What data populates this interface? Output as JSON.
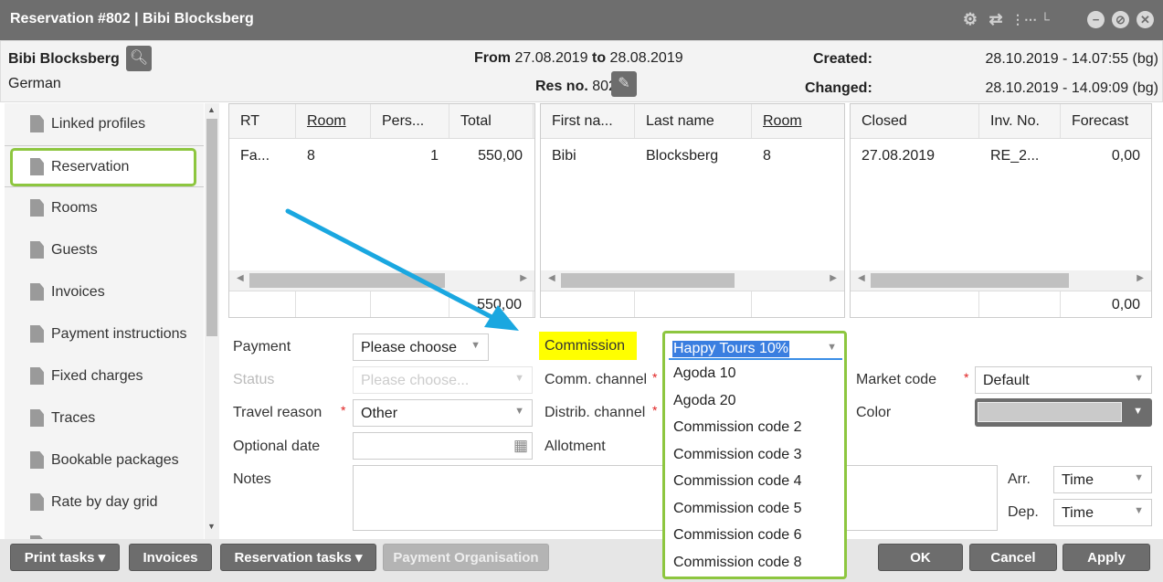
{
  "window": {
    "title": "Reservation #802 | Bibi Blocksberg",
    "icons": [
      "gear-icon",
      "swap-icon",
      "tree-icon",
      "hierarchy-icon",
      "minimize-icon",
      "restore-icon",
      "close-icon"
    ]
  },
  "header": {
    "guest_name": "Bibi Blocksberg",
    "language": "German",
    "from_label": "From",
    "from_date": "27.08.2019",
    "to_label": "to",
    "to_date": "28.08.2019",
    "resno_label": "Res no.",
    "resno": "802",
    "created_label": "Created:",
    "created": "28.10.2019 - 14.07:55 (bg)",
    "changed_label": "Changed:",
    "changed": "28.10.2019 - 14.09:09 (bg)"
  },
  "sidebar": {
    "items": [
      {
        "label": "Linked profiles"
      },
      {
        "label": "Reservation",
        "selected": true
      },
      {
        "label": "Rooms"
      },
      {
        "label": "Guests"
      },
      {
        "label": "Invoices"
      },
      {
        "label": "Payment instructions"
      },
      {
        "label": "Fixed charges"
      },
      {
        "label": "Traces"
      },
      {
        "label": "Bookable packages"
      },
      {
        "label": "Rate by day grid"
      }
    ]
  },
  "rooms_table": {
    "headers": [
      "RT",
      "Room",
      "Pers...",
      "Total"
    ],
    "row": [
      "Fa...",
      "8",
      "1",
      "550,00"
    ],
    "footer_total": "550,00"
  },
  "guests_table": {
    "headers": [
      "First na...",
      "Last name",
      "Room"
    ],
    "row": [
      "Bibi",
      "Blocksberg",
      "8"
    ]
  },
  "invoices_table": {
    "headers": [
      "Closed",
      "Inv. No.",
      "Forecast"
    ],
    "row": [
      "27.08.2019",
      "RE_2...",
      "0,00"
    ],
    "footer_total": "0,00"
  },
  "form": {
    "payment_label": "Payment",
    "payment_value": "Please choose",
    "status_label": "Status",
    "status_value": "Please choose...",
    "travel_label": "Travel reason",
    "travel_value": "Other",
    "optional_label": "Optional date",
    "notes_label": "Notes",
    "commission_label": "Commission",
    "commission_value": "Happy Tours 10%",
    "comm_channel_label": "Comm. channel",
    "distrib_channel_label": "Distrib. channel",
    "allotment_label": "Allotment",
    "market_label": "Market code",
    "market_value": "Default",
    "color_label": "Color",
    "arr_label": "Arr.",
    "arr_value": "Time",
    "dep_label": "Dep.",
    "dep_value": "Time"
  },
  "commission_options": [
    "Agoda 10",
    "Agoda 20",
    "Commission code 2",
    "Commission code 3",
    "Commission code 4",
    "Commission code 5",
    "Commission code 6",
    "Commission code 8"
  ],
  "footer": {
    "print_tasks": "Print tasks",
    "invoices": "Invoices",
    "reservation_tasks": "Reservation tasks",
    "payment_org": "Payment Organisation",
    "ok": "OK",
    "cancel": "Cancel",
    "apply": "Apply"
  },
  "colors": {
    "highlight_green": "#8dc63f",
    "arrow_blue": "#1aa7e0",
    "commission_highlight": "#ffff00",
    "titlebar": "#6e6e6e"
  }
}
